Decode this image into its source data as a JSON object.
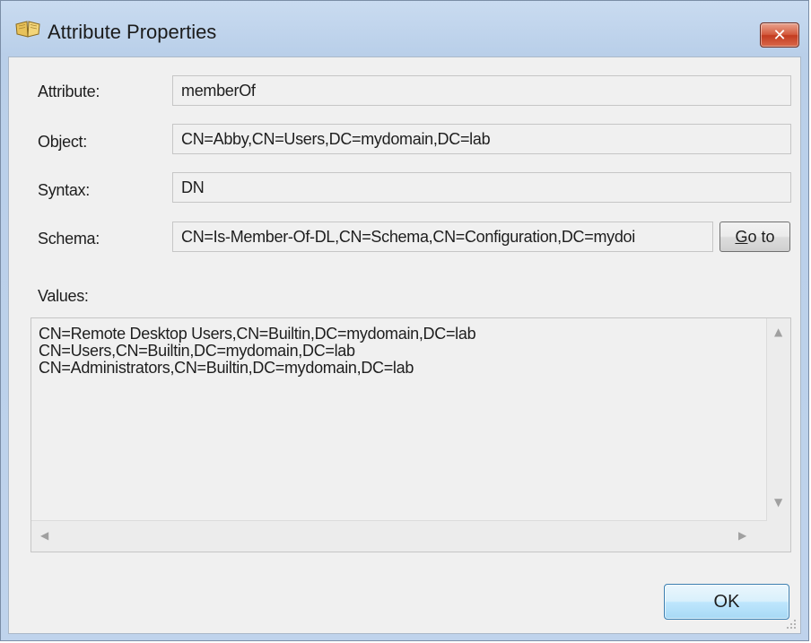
{
  "window": {
    "title": "Attribute Properties",
    "close_glyph": "✕",
    "icon": "book-icon"
  },
  "form": {
    "attribute_label": "Attribute:",
    "attribute_value": "memberOf",
    "object_label": "Object:",
    "object_value": "CN=Abby,CN=Users,DC=mydomain,DC=lab",
    "syntax_label": "Syntax:",
    "syntax_value": "DN",
    "schema_label": "Schema:",
    "schema_value": "CN=Is-Member-Of-DL,CN=Schema,CN=Configuration,DC=mydoi",
    "goto_first": "G",
    "goto_rest": "o to"
  },
  "values": {
    "label": "Values:",
    "items": [
      "CN=Remote Desktop Users,CN=Builtin,DC=mydomain,DC=lab",
      "CN=Users,CN=Builtin,DC=mydomain,DC=lab",
      "CN=Administrators,CN=Builtin,DC=mydomain,DC=lab"
    ]
  },
  "buttons": {
    "ok": "OK"
  },
  "colors": {
    "close_red": "#c33b20",
    "ok_blue": "#bee6fd",
    "frame": "#b9cfe9"
  }
}
